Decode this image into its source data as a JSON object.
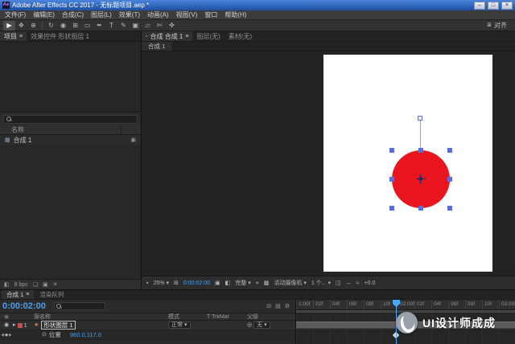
{
  "colors": {
    "titlebar_blue": "#2a63c8",
    "circle_red": "#e8141e",
    "selection_blue": "#5a6ee0",
    "time_blue": "#49a0f0"
  },
  "title_bar": {
    "app_icon": "Ae",
    "title": "Adobe After Effects CC 2017 - 无标题项目.aep *",
    "minimize": "–",
    "maximize": "□",
    "close": "×"
  },
  "menu_bar": {
    "items": [
      "文件(F)",
      "编辑(E)",
      "合成(C)",
      "图层(L)",
      "效果(T)",
      "动画(A)",
      "视图(V)",
      "窗口",
      "帮助(H)"
    ]
  },
  "toolbar": {
    "align_icon": "≣",
    "align_label": "对齐",
    "tools": [
      {
        "name": "selection",
        "glyph": "▶"
      },
      {
        "name": "hand",
        "glyph": "✥"
      },
      {
        "name": "zoom",
        "glyph": "⊕"
      },
      {
        "name": "rotation",
        "glyph": "↻"
      },
      {
        "name": "camera",
        "glyph": "◉"
      },
      {
        "name": "pan-behind",
        "glyph": "⊞"
      },
      {
        "name": "shape",
        "glyph": "▭"
      },
      {
        "name": "pen",
        "glyph": "✒"
      },
      {
        "name": "type",
        "glyph": "T"
      },
      {
        "name": "brush",
        "glyph": "✎"
      },
      {
        "name": "clone-stamp",
        "glyph": "▣"
      },
      {
        "name": "eraser",
        "glyph": "▱"
      },
      {
        "name": "roto-brush",
        "glyph": "✄"
      },
      {
        "name": "puppet",
        "glyph": "✜"
      }
    ]
  },
  "icons": {
    "menu": "≡",
    "dropdown": "▾",
    "twirl_closed": "▸",
    "eye": "◉",
    "star": "★",
    "stopwatch": "⊙",
    "diamond": "◆",
    "keynav_left": "◀",
    "keynav_right": "▶",
    "pickwhip": "◎",
    "comp_item": "▦",
    "comp_badge": "▣",
    "grid": "⊞",
    "snapshot": "▣",
    "channels": "◧",
    "roi": "⌖",
    "transparency": "▩",
    "view_layout": "◫",
    "pixel_aspect": "↔",
    "fast_preview": "≈",
    "mini_flowchart": "⊟",
    "draft": "▤",
    "settings_gear": "⚙",
    "lock": "▪",
    "panel": "▪",
    "folder": "❏",
    "new_comp": "▣",
    "trash": "✕",
    "interpret": "◧"
  },
  "project_panel": {
    "tab_project": "项目",
    "tab_effects": "效果控件 形状图层 1",
    "name_column": "名称",
    "items": [
      {
        "label": "合成 1"
      }
    ],
    "bpc_label": "8 bpc"
  },
  "comp_panel": {
    "tab_comp": "合成 合成 1",
    "tab_layer": "图层(无)",
    "tab_footage": "素材(无)",
    "viewer_tab": "合成 1",
    "zoom": "25%",
    "time": "0:00:02:00",
    "resolution": "完整",
    "camera": "活动摄像机",
    "views": "1 个...",
    "exposure": "+0.0"
  },
  "timeline": {
    "tab_comp": "合成 1",
    "tab_render_queue": "渲染队列",
    "current_time": "0:00:02:00",
    "col_source_name": "源名称",
    "col_mode": "模式",
    "col_trkmat": "T TrkMat",
    "col_parent": "父级",
    "layer": {
      "index": "1",
      "name": "形状图层 1",
      "mode": "正常",
      "parent": "无"
    },
    "property": {
      "name": "位置",
      "value": "960.0,117.0"
    },
    "ruler": [
      "1:00f",
      "02f",
      "04f",
      "06f",
      "08f",
      "10f",
      "02:00f",
      "02f",
      "04f",
      "06f",
      "08f",
      "10f",
      "03:00f"
    ]
  },
  "watermark": {
    "text": "UI设计师成成"
  }
}
